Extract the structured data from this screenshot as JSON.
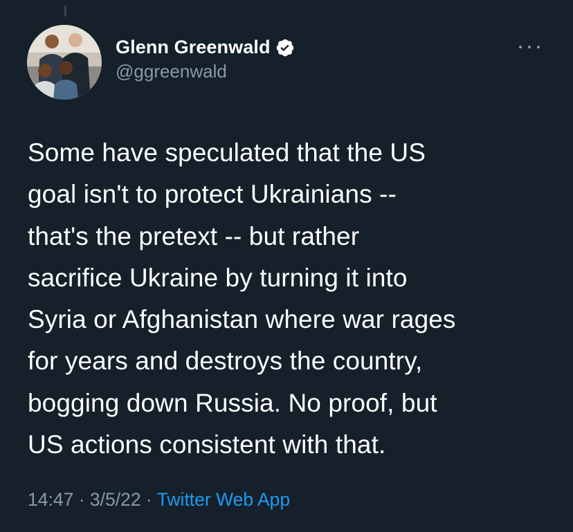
{
  "tweet": {
    "author": {
      "display_name": "Glenn Greenwald",
      "handle": "@ggreenwald",
      "verified": true,
      "avatar_icon": "profile-photo"
    },
    "text": "Some have speculated that the US\ngoal isn't to protect Ukrainians --\nthat's the pretext -- but rather\nsacrifice Ukraine by turning it into\nSyria or Afghanistan where war rages\nfor years and destroys the country,\nbogging down Russia. No proof, but\nUS actions consistent with that.",
    "time": "14:47",
    "date": "3/5/22",
    "separator": "·",
    "source": "Twitter Web App"
  },
  "icons": {
    "verified": "verified-badge-icon",
    "more": "more-options-icon"
  },
  "colors": {
    "background": "#15202b",
    "text": "#ffffff",
    "muted": "#8b98a5",
    "accent": "#1d9bf0"
  }
}
